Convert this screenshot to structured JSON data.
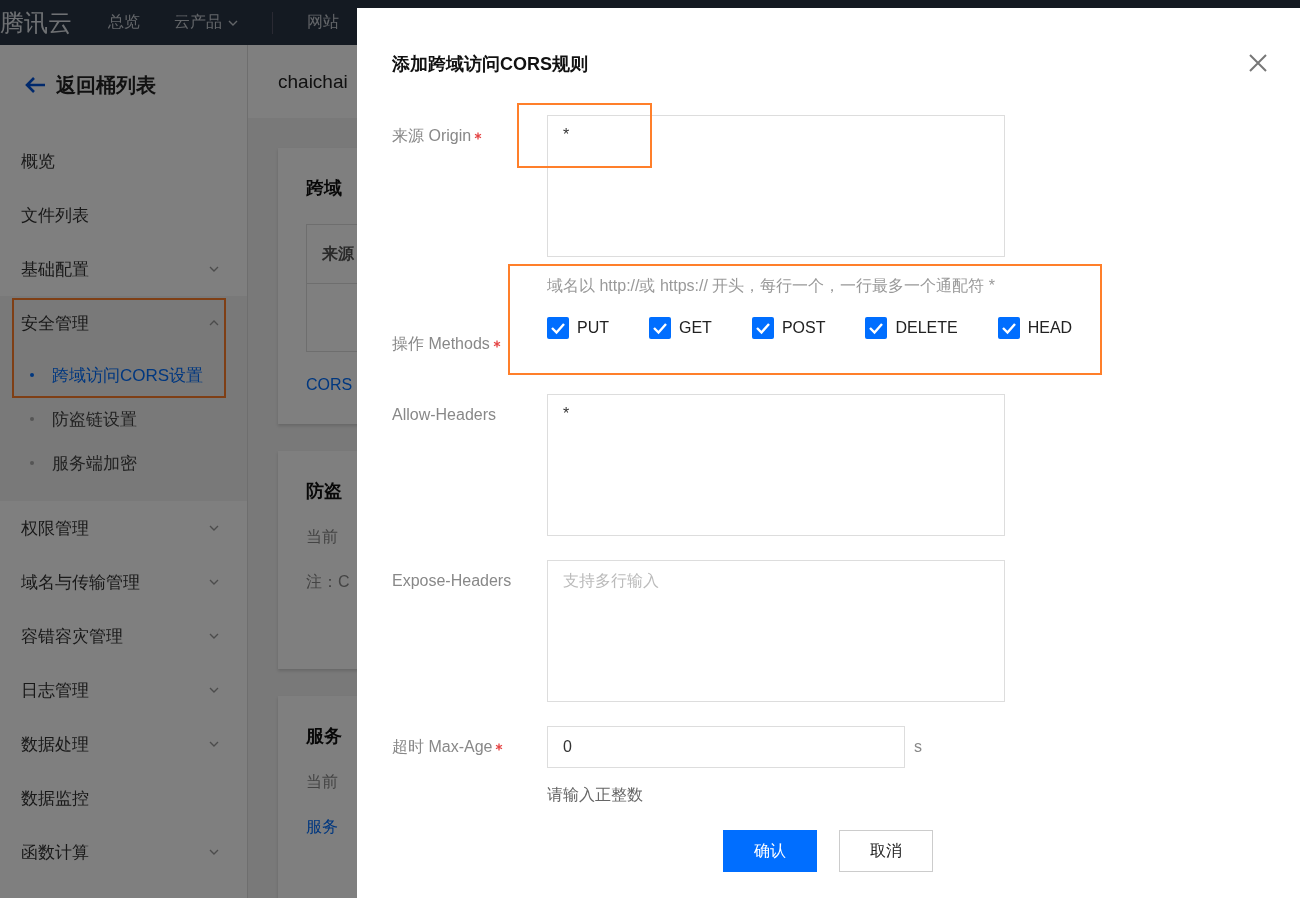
{
  "top_bar": {
    "logo": "腾讯云",
    "nav": [
      {
        "label": "总览",
        "dropdown": false
      },
      {
        "label": "云产品",
        "dropdown": true
      },
      {
        "label": "网站",
        "dropdown": false
      }
    ]
  },
  "sidebar": {
    "back_link": "返回桶列表",
    "items": [
      {
        "kind": "link",
        "label": "概览"
      },
      {
        "kind": "link",
        "label": "文件列表"
      },
      {
        "kind": "group",
        "label": "基础配置",
        "expanded": false,
        "highlighted": false
      },
      {
        "kind": "group",
        "label": "安全管理",
        "expanded": true,
        "highlighted": true,
        "children": [
          {
            "label": "跨域访问CORS设置",
            "selected": true
          },
          {
            "label": "防盗链设置",
            "selected": false
          },
          {
            "label": "服务端加密",
            "selected": false
          }
        ]
      },
      {
        "kind": "group",
        "label": "权限管理",
        "expanded": false,
        "highlighted": false
      },
      {
        "kind": "group",
        "label": "域名与传输管理",
        "expanded": false,
        "highlighted": false
      },
      {
        "kind": "group",
        "label": "容错容灾管理",
        "expanded": false,
        "highlighted": false
      },
      {
        "kind": "group",
        "label": "日志管理",
        "expanded": false,
        "highlighted": false
      },
      {
        "kind": "group",
        "label": "数据处理",
        "expanded": false,
        "highlighted": false
      },
      {
        "kind": "link",
        "label": "数据监控"
      },
      {
        "kind": "group",
        "label": "函数计算",
        "expanded": false,
        "highlighted": false
      }
    ]
  },
  "main": {
    "bucket_name": "chaichai",
    "cards": [
      {
        "items": [
          {
            "kind": "title",
            "text": "跨域"
          },
          {
            "kind": "table",
            "text": "来源"
          },
          {
            "kind": "link",
            "text": "CORS"
          }
        ]
      },
      {
        "items": [
          {
            "kind": "title",
            "text": "防盗"
          },
          {
            "kind": "text",
            "text": "当前"
          },
          {
            "kind": "text",
            "text": "注：C"
          }
        ]
      },
      {
        "items": [
          {
            "kind": "title",
            "text": "服务"
          },
          {
            "kind": "text",
            "text": "当前"
          },
          {
            "kind": "link",
            "text": "服务"
          }
        ]
      }
    ]
  },
  "dialog": {
    "title": "添加跨域访问CORS规则",
    "fields": [
      {
        "kind": "textarea",
        "label": "来源 Origin",
        "required": true,
        "value": "*",
        "highlighted": true
      },
      {
        "kind": "checkboxes",
        "label": "操作 Methods",
        "required": true,
        "hint": "域名以 http://或 https:// 开头，每行一个，一行最多一个通配符 *",
        "highlighted": true,
        "options": [
          {
            "label": "PUT",
            "checked": true
          },
          {
            "label": "GET",
            "checked": true
          },
          {
            "label": "POST",
            "checked": true
          },
          {
            "label": "DELETE",
            "checked": true
          },
          {
            "label": "HEAD",
            "checked": true
          }
        ]
      },
      {
        "kind": "textarea",
        "label": "Allow-Headers",
        "required": false,
        "value": "*",
        "highlighted": false
      },
      {
        "kind": "textarea",
        "label": "Expose-Headers",
        "required": false,
        "placeholder": "支持多行输入",
        "highlighted": false
      },
      {
        "kind": "input",
        "label": "超时 Max-Age",
        "required": true,
        "value": "0",
        "unit": "s",
        "hint": "请输入正整数",
        "highlighted": false
      }
    ],
    "buttons": [
      {
        "label": "确认",
        "primary": true
      },
      {
        "label": "取消",
        "primary": false
      }
    ]
  }
}
